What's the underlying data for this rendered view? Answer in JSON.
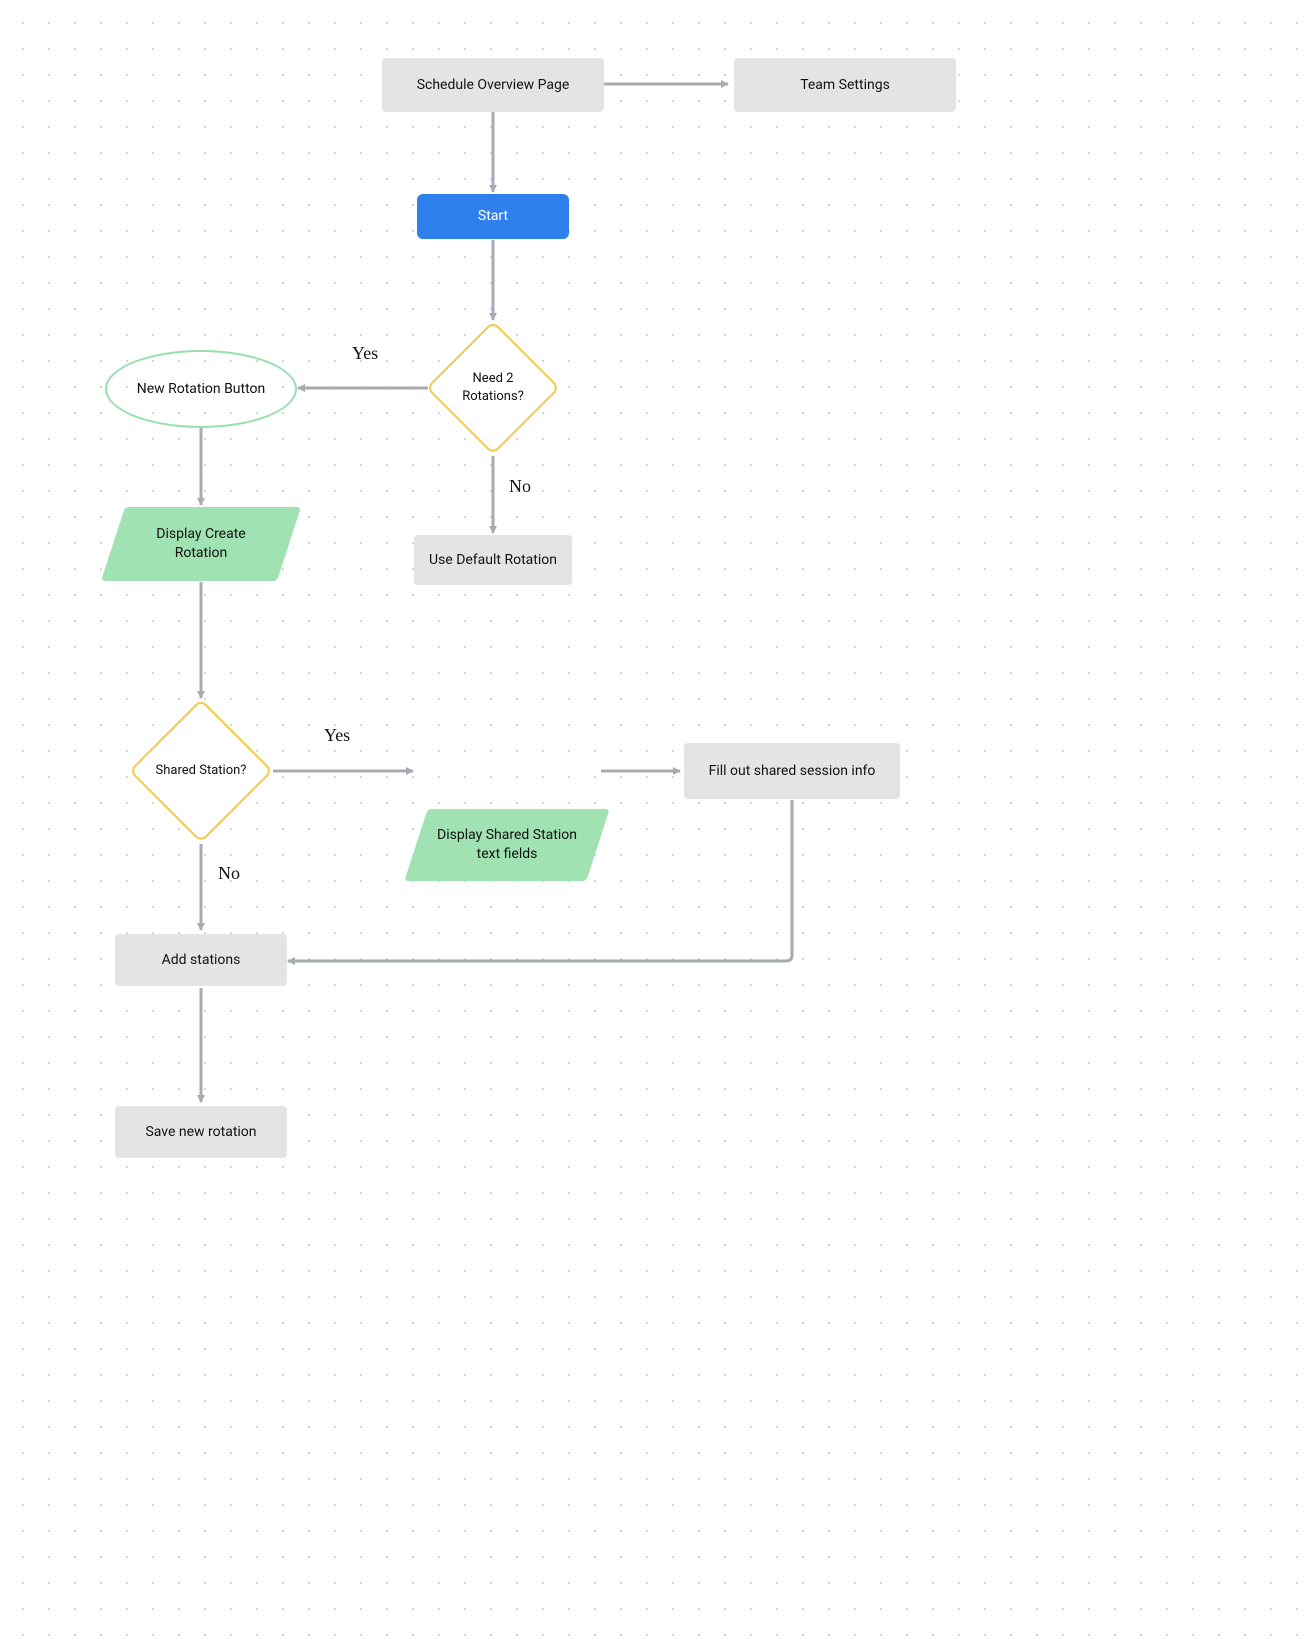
{
  "nodes": {
    "schedule_overview": "Schedule Overview Page",
    "team_settings": "Team Settings",
    "start": "Start",
    "need2rotations": "Need 2 Rotations?",
    "new_rotation_button": "New Rotation Button",
    "use_default_rotation": "Use Default Rotation",
    "display_create_rotation": "Display Create Rotation",
    "shared_station": "Shared Station?",
    "display_shared_station": "Display Shared Station text fields",
    "fill_out_shared": "Fill out shared session info",
    "add_stations": "Add stations",
    "save_new_rotation": "Save new rotation"
  },
  "edge_labels": {
    "yes1": "Yes",
    "no1": "No",
    "yes2": "Yes",
    "no2": "No"
  },
  "colors": {
    "arrow": "#a7acb3",
    "diamond_border": "#f2c94c",
    "parallelogram_fill": "#a0e2b1",
    "ellipse_border": "#97e0ae",
    "rect_fill": "#e4e4e5",
    "start_fill": "#2f80ed"
  }
}
